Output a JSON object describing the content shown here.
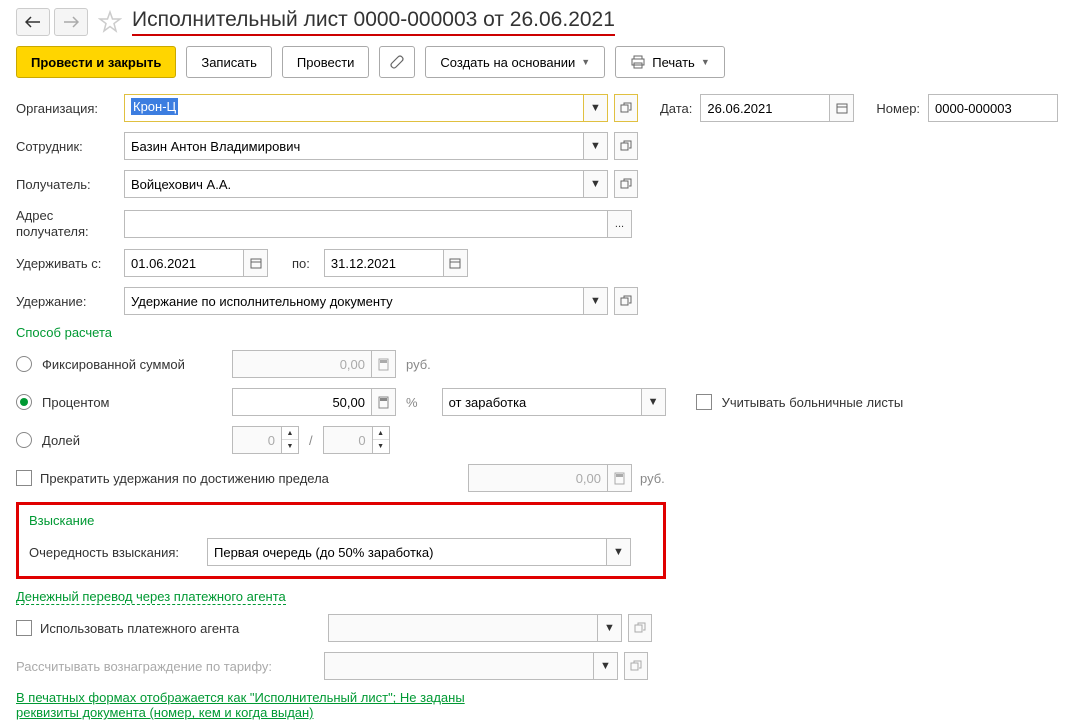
{
  "header": {
    "title": "Исполнительный лист 0000-000003 от 26.06.2021"
  },
  "toolbar": {
    "post_close": "Провести и закрыть",
    "save": "Записать",
    "post": "Провести",
    "create_based": "Создать на основании",
    "print": "Печать"
  },
  "fields": {
    "org_label": "Организация:",
    "org_value": "Крон-Ц",
    "date_label": "Дата:",
    "date_value": "26.06.2021",
    "number_label": "Номер:",
    "number_value": "0000-000003",
    "employee_label": "Сотрудник:",
    "employee_value": "Базин Антон Владимирович",
    "recipient_label": "Получатель:",
    "recipient_value": "Войцехович А.А.",
    "recipient_addr_label": "Адрес получателя:",
    "withhold_from_label": "Удерживать с:",
    "withhold_from_value": "01.06.2021",
    "withhold_to_label": "по:",
    "withhold_to_value": "31.12.2021",
    "deduction_label": "Удержание:",
    "deduction_value": "Удержание по исполнительному документу"
  },
  "calc": {
    "section_title": "Способ расчета",
    "opt_fixed": "Фиксированной суммой",
    "fixed_value": "0,00",
    "fixed_unit": "руб.",
    "opt_percent": "Процентом",
    "percent_value": "50,00",
    "percent_unit": "%",
    "percent_base": "от заработка",
    "sick_leave": "Учитывать больничные листы",
    "opt_fraction": "Долей",
    "frac_num": "0",
    "frac_den": "0",
    "frac_sep": "/",
    "stop_limit": "Прекратить удержания по достижению предела",
    "limit_value": "0,00",
    "limit_unit": "руб."
  },
  "collection": {
    "section_title": "Взыскание",
    "priority_label": "Очередность взыскания:",
    "priority_value": "Первая очередь (до 50% заработка)"
  },
  "transfer": {
    "section_title": "Денежный перевод через платежного агента",
    "use_agent": "Использовать платежного агента",
    "fee_label": "Рассчитывать вознаграждение по тарифу:"
  },
  "footer": {
    "link_text": "В печатных формах отображается как \"Исполнительный лист\"; Не заданы реквизиты документа (номер, кем и когда выдан)"
  }
}
